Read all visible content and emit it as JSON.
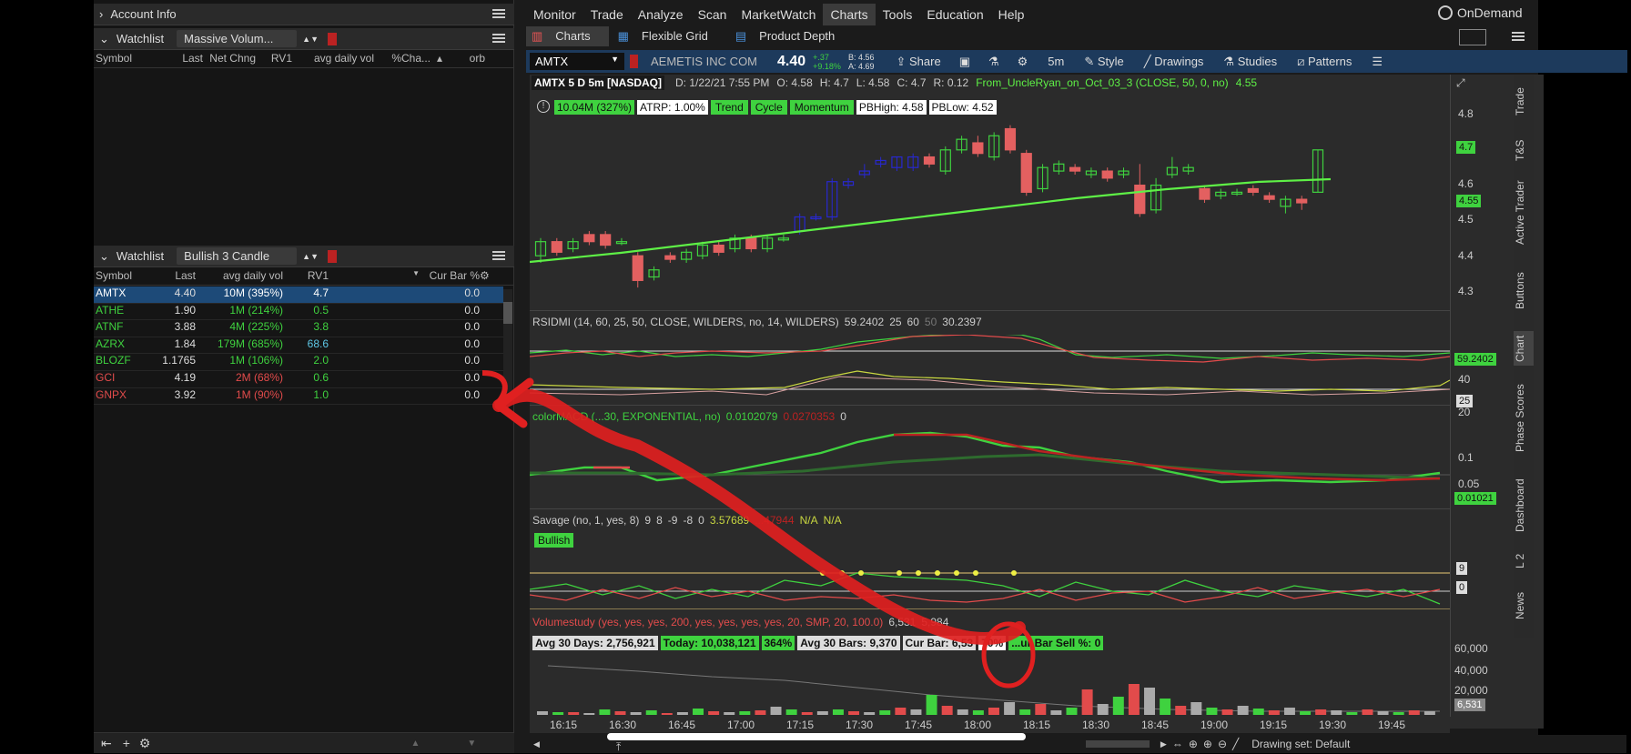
{
  "account_info": "Account Info",
  "watchlist1": {
    "label": "Watchlist",
    "name": "Massive Volum...",
    "columns": [
      "Symbol",
      "Last",
      "Net Chng",
      "RV1",
      "avg daily vol",
      "%Cha...",
      "orb"
    ]
  },
  "watchlist2": {
    "label": "Watchlist",
    "name": "Bullish 3 Candle",
    "columns": [
      "Symbol",
      "Last",
      "avg daily vol",
      "RV1",
      "Cur Bar %"
    ],
    "rows": [
      {
        "sym": "AMTX",
        "last": "4.40",
        "vol": "10M (395%)",
        "rv1": "4.7",
        "cur": "0.0",
        "symcolor": "#ffffff",
        "volcolor": "#ffffff",
        "rvcolor": "#ffffff"
      },
      {
        "sym": "ATHE",
        "last": "1.90",
        "vol": "1M (214%)",
        "rv1": "0.5",
        "cur": "0.0",
        "symcolor": "#3fd23f",
        "volcolor": "#3fd23f",
        "rvcolor": "#3fd23f"
      },
      {
        "sym": "ATNF",
        "last": "3.88",
        "vol": "4M (225%)",
        "rv1": "3.8",
        "cur": "0.0",
        "symcolor": "#3fd23f",
        "volcolor": "#3fd23f",
        "rvcolor": "#3fd23f"
      },
      {
        "sym": "AZRX",
        "last": "1.84",
        "vol": "179M (685%)",
        "rv1": "68.6",
        "cur": "0.0",
        "symcolor": "#3fd23f",
        "volcolor": "#3fd23f",
        "rvcolor": "#5ec8e6"
      },
      {
        "sym": "BLOZF",
        "last": "1.1765",
        "vol": "1M (106%)",
        "rv1": "2.0",
        "cur": "0.0",
        "symcolor": "#3fd23f",
        "volcolor": "#3fd23f",
        "rvcolor": "#3fd23f"
      },
      {
        "sym": "GCI",
        "last": "4.19",
        "vol": "2M (68%)",
        "rv1": "0.6",
        "cur": "0.0",
        "symcolor": "#e24b4b",
        "volcolor": "#e24b4b",
        "rvcolor": "#3fd23f"
      },
      {
        "sym": "GNPX",
        "last": "3.92",
        "vol": "1M (90%)",
        "rv1": "1.0",
        "cur": "0.0",
        "symcolor": "#e24b4b",
        "volcolor": "#e24b4b",
        "rvcolor": "#3fd23f"
      }
    ]
  },
  "menu": [
    "Monitor",
    "Trade",
    "Analyze",
    "Scan",
    "MarketWatch",
    "Charts",
    "Tools",
    "Education",
    "Help"
  ],
  "ondemand": "OnDemand",
  "subtabs": [
    "Charts",
    "Flexible Grid",
    "Product Depth"
  ],
  "toolbar": {
    "symbol": "AMTX",
    "company": "AEMETIS INC COM",
    "price": "4.40",
    "chg": "+.37",
    "chgpct": "+9.18%",
    "bid": "B: 4.56",
    "ask": "A: 4.69",
    "share": "Share",
    "timeframe": "5m",
    "style": "Style",
    "drawings": "Drawings",
    "studies": "Studies",
    "patterns": "Patterns"
  },
  "price_panel": {
    "header": "AMTX 5 D 5m [NASDAQ]",
    "date": "D: 1/22/21 7:55 PM",
    "o": "O: 4.58",
    "h": "H: 4.7",
    "l": "L: 4.58",
    "c": "C: 4.7",
    "r": "R: 0.12",
    "study": "From_UncleRyan_on_Oct_03_3 (CLOSE, 50, 0, no)",
    "study_val": "4.55",
    "badges": [
      "10.04M (327%)",
      "ATRP: 1.00%",
      "Trend",
      "Cycle",
      "Momentum",
      "PBHigh: 4.58",
      "PBLow: 4.52"
    ],
    "yticks": [
      "4.8",
      "4.7",
      "4.6",
      "4.55",
      "4.5",
      "4.4",
      "4.3"
    ]
  },
  "rsi_panel": {
    "label": "RSIDMI (14, 60, 25, 50, CLOSE, WILDERS, no, 14, WILDERS)",
    "v1": "59.2402",
    "v2": "25",
    "v3": "60",
    "v4": "50",
    "v5": "30.2397",
    "tag": "59.2402",
    "y40": "40",
    "y25": "25",
    "y20": "20"
  },
  "macd_panel": {
    "label": "colorMACD (...30, EXPONENTIAL, no)",
    "v1": "0.0102079",
    "v2": "0.0270353",
    "v3": "0",
    "y1": "0.1",
    "y2": "0.05",
    "y3": "0",
    "tag": "0.01021"
  },
  "savage_panel": {
    "label": "Savage (no, 1, yes, 8)",
    "vals": [
      "9",
      "8",
      "-9",
      "-8",
      "0",
      "3.57689",
      "...47944",
      "N/A",
      "N/A"
    ],
    "bullish": "Bullish",
    "t9": "9",
    "t0": "0"
  },
  "vol_panel": {
    "label": "Volumestudy (yes, yes, yes, 200, yes, yes, yes, yes, 20, SMP, 20, 100.0)",
    "v1": "6,531",
    "v2": "5,984",
    "badges": [
      "Avg 30 Days: 2,756,921",
      "Today: 10,038,121",
      "364%",
      "Avg 30 Bars: 9,370",
      "Cur Bar: 6,53",
      "70%",
      "...ur Bar Sell %: 0"
    ],
    "yticks": [
      "60,000",
      "40,000",
      "20,000"
    ],
    "tag": "6,531"
  },
  "xaxis": [
    "16:15",
    "16:30",
    "16:45",
    "17:00",
    "17:15",
    "17:30",
    "17:45",
    "18:00",
    "18:15",
    "18:30",
    "18:45",
    "19:00",
    "19:15",
    "19:30",
    "19:45"
  ],
  "drawing_set": "Drawing set: Default",
  "side_tabs": [
    "Trade",
    "T&S",
    "Active Trader",
    "Buttons",
    "Chart",
    "Phase Scores",
    "Dashboard",
    "L 2",
    "News"
  ],
  "colors": {
    "up": "#3fd23f",
    "down": "#e36060",
    "blue": "#2828d0",
    "sma": "#5ef046",
    "annot": "#e02020"
  }
}
